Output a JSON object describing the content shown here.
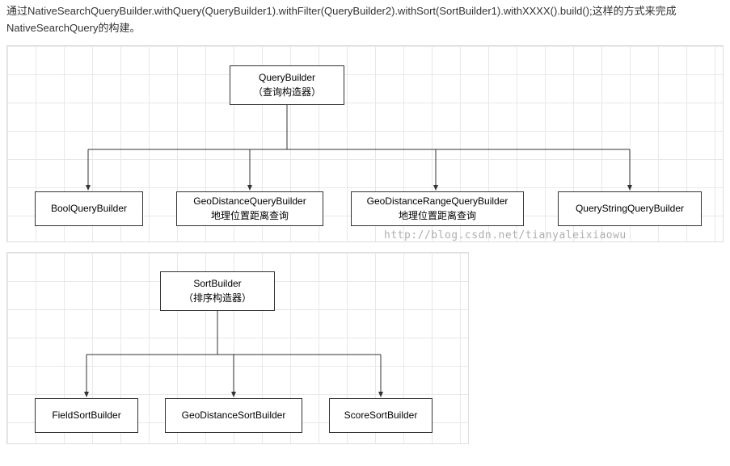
{
  "intro": {
    "line1": "通过NativeSearchQueryBuilder.withQuery(QueryBuilder1).withFilter(QueryBuilder2).withSort(SortBuilder1).withXXXX().build();这样的方式来完成",
    "line2": "NativeSearchQuery的构建。"
  },
  "diagram1": {
    "root": {
      "title": "QueryBuilder",
      "subtitle": "（查询构造器）"
    },
    "children": [
      {
        "title": "BoolQueryBuilder",
        "subtitle": ""
      },
      {
        "title": "GeoDistanceQueryBuilder",
        "subtitle": "地理位置距离查询"
      },
      {
        "title": "GeoDistanceRangeQueryBuilder",
        "subtitle": "地理位置距离查询"
      },
      {
        "title": "QueryStringQueryBuilder",
        "subtitle": ""
      }
    ],
    "watermark": "http://blog.csdn.net/tianyaleixiaowu"
  },
  "diagram2": {
    "root": {
      "title": "SortBuilder",
      "subtitle": "（排序构造器）"
    },
    "children": [
      {
        "title": "FieldSortBuilder",
        "subtitle": ""
      },
      {
        "title": "GeoDistanceSortBuilder",
        "subtitle": ""
      },
      {
        "title": "ScoreSortBuilder",
        "subtitle": ""
      }
    ]
  }
}
